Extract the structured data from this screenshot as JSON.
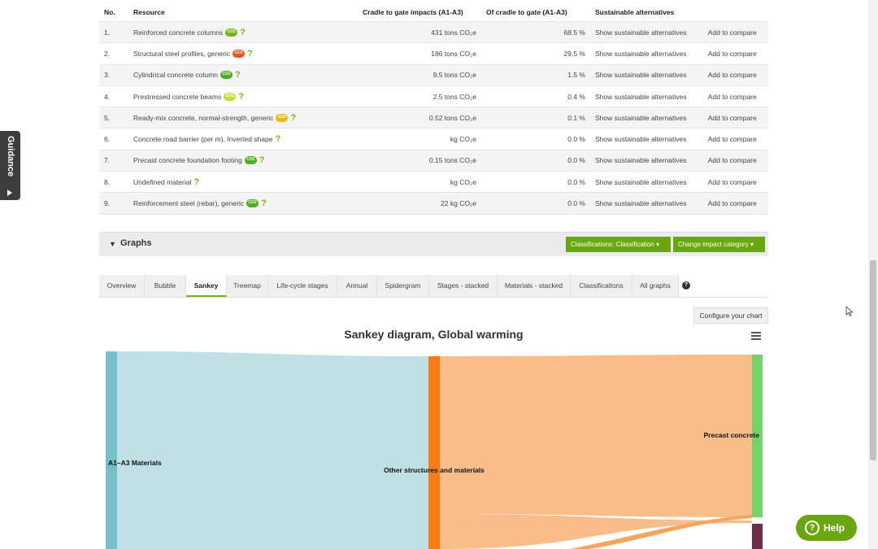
{
  "table": {
    "headers": [
      "No.",
      "Resource",
      "Cradle to gate impacts (A1-A3)",
      "Of cradle to gate (A1-A3)",
      "Sustainable alternatives"
    ],
    "rows": [
      {
        "no": "1.",
        "resource": "Reinforced concrete columns",
        "badge_color": "#7ab317",
        "impact": "431 tons CO₂e",
        "share": "68.5 %",
        "alt": "Show sustainable alternatives",
        "compare": "Add to compare"
      },
      {
        "no": "2.",
        "resource": "Structural steel profiles, generic",
        "badge_color": "#e4571b",
        "impact": "186 tons CO₂e",
        "share": "29.5 %",
        "alt": "Show sustainable alternatives",
        "compare": "Add to compare"
      },
      {
        "no": "3.",
        "resource": "Cylindrical concrete column",
        "badge_color": "#4caf1f",
        "impact": "9.5 tons CO₂e",
        "share": "1.5 %",
        "alt": "Show sustainable alternatives",
        "compare": "Add to compare"
      },
      {
        "no": "4.",
        "resource": "Prestressed concrete beams",
        "badge_color": "#c8e032",
        "impact": "2.5 tons CO₂e",
        "share": "0.4 %",
        "alt": "Show sustainable alternatives",
        "compare": "Add to compare"
      },
      {
        "no": "5.",
        "resource": "Ready-mix concrete, normal-strength, generic",
        "badge_color": "#f5b514",
        "impact": "0.52 tons CO₂e",
        "share": "0.1 %",
        "alt": "Show sustainable alternatives",
        "compare": "Add to compare"
      },
      {
        "no": "6.",
        "resource": "Concrete road barrier (per m), Inverted shape",
        "badge_color": "",
        "impact": "kg CO₂e",
        "share": "0.0 %",
        "alt": "Show sustainable alternatives",
        "compare": "Add to compare"
      },
      {
        "no": "7.",
        "resource": "Precast concrete foundation footing",
        "badge_color": "#4caf1f",
        "impact": "0.15 tons CO₂e",
        "share": "0.0 %",
        "alt": "Show sustainable alternatives",
        "compare": "Add to compare"
      },
      {
        "no": "8.",
        "resource": "Undefined material",
        "badge_color": "",
        "impact": "kg CO₂e",
        "share": "0.0 %",
        "alt": "Show sustainable alternatives",
        "compare": "Add to compare"
      },
      {
        "no": "9.",
        "resource": "Reinforcement steel (rebar), generic",
        "badge_color": "#4caf1f",
        "impact": "22 kg CO₂e",
        "share": "0.0 %",
        "alt": "Show sustainable alternatives",
        "compare": "Add to compare"
      }
    ]
  },
  "graphs": {
    "title": "Graphs",
    "classification_button": "Classifications: Classification",
    "impact_button": "Change impact category",
    "tabs": [
      "Overview",
      "Bubble",
      "Sankey",
      "Treemap",
      "Life-cycle stages",
      "Annual",
      "Spidergram",
      "Stages - stacked",
      "Materials - stacked",
      "Classifications",
      "All graphs"
    ],
    "active_tab": "Sankey",
    "configure_button": "Configure your chart",
    "chart_title": "Sankey diagram, Global warming",
    "nodes": {
      "source": "A1–A3 Materials",
      "middle": "Other structures and materials",
      "target": "Precast concrete"
    }
  },
  "guidance_label": "Guidance",
  "help_label": "Help",
  "colors": {
    "accent_green": "#7ab317",
    "button_green": "#6aa70f",
    "node_source": "#77bfcb",
    "node_middle": "#f57b13",
    "node_target": "#74d26b",
    "node_dark": "#6e2c48",
    "link_first": "#bfe0e4",
    "link_second": "#f8bd88"
  }
}
